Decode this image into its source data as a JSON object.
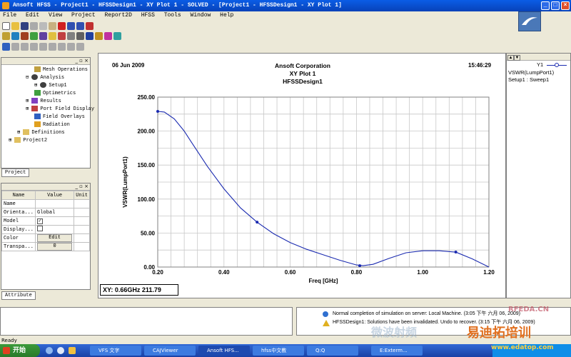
{
  "window": {
    "title": "Ansoft HFSS - Project1 - HFSSDesign1 - XY Plot 1 - SOLVED - [Project1 - HFSSDesign1 - XY Plot 1]"
  },
  "menu": [
    "File",
    "Edit",
    "View",
    "Project",
    "Report2D",
    "HFSS",
    "Tools",
    "Window",
    "Help"
  ],
  "tree": {
    "items": [
      {
        "label": "Mesh Operations"
      },
      {
        "label": "Analysis"
      },
      {
        "label": "Setup1"
      },
      {
        "label": "Optimetrics"
      },
      {
        "label": "Results"
      },
      {
        "label": "Port Field Display"
      },
      {
        "label": "Field Overlays"
      },
      {
        "label": "Radiation"
      },
      {
        "label": "Definitions"
      },
      {
        "label": "Project2"
      }
    ],
    "tab": "Project"
  },
  "properties": {
    "headers": [
      "Name",
      "Value",
      "Unit"
    ],
    "rows": [
      {
        "name": "Name",
        "value": ""
      },
      {
        "name": "Orienta...",
        "value": "Global"
      },
      {
        "name": "Model",
        "value": "✓"
      },
      {
        "name": "Display...",
        "value": ""
      },
      {
        "name": "Color",
        "value": "Edit"
      },
      {
        "name": "Transpa...",
        "value": "0"
      }
    ],
    "tab": "Attribute"
  },
  "plot": {
    "date": "06 Jun 2009",
    "time": "15:46:29",
    "company": "Ansoft Corporation",
    "readout": "XY: 0.66GHz 211.79"
  },
  "chart_data": {
    "type": "line",
    "title": "XY Plot 1",
    "subtitle": "HFSSDesign1",
    "xlabel": "Freq [GHz]",
    "ylabel": "VSWR(LumpPort1)",
    "xlim": [
      0.2,
      1.2
    ],
    "ylim": [
      0,
      250
    ],
    "xticks": [
      "0.20",
      "0.40",
      "0.60",
      "0.80",
      "1.00",
      "1.20"
    ],
    "yticks": [
      "0.00",
      "50.00",
      "100.00",
      "150.00",
      "200.00",
      "250.00"
    ],
    "grid": true,
    "series": [
      {
        "name": "VSWR(LumpPort1)",
        "color": "#1a2ab0",
        "x": [
          0.2,
          0.22,
          0.25,
          0.28,
          0.3,
          0.35,
          0.4,
          0.45,
          0.5,
          0.55,
          0.6,
          0.65,
          0.7,
          0.75,
          0.8,
          0.82,
          0.85,
          0.9,
          0.95,
          1.0,
          1.05,
          1.1,
          1.15,
          1.2
        ],
        "values": [
          229,
          228,
          218,
          200,
          185,
          148,
          115,
          87,
          66,
          49,
          36,
          26,
          18,
          10,
          3,
          2,
          4,
          13,
          21,
          24,
          24,
          22,
          12,
          0
        ]
      }
    ],
    "markers": [
      {
        "x": 0.2,
        "y": 229
      },
      {
        "x": 0.5,
        "y": 66
      },
      {
        "x": 0.81,
        "y": 2
      },
      {
        "x": 1.1,
        "y": 22
      }
    ]
  },
  "legend": {
    "name": "Y1",
    "lines": [
      "VSWR(LumpPort1)",
      "Setup1 : Sweep1"
    ]
  },
  "messages": [
    "Normal completion of simulation on server: Local Machine. (3:05 下午 六月 06, 2009)",
    "HFSSDesign1: Solutions have been invalidated. Undo to recover. (3:15 下午 六月 06, 2009)"
  ],
  "status": "Ready",
  "taskbar": {
    "start": "开始",
    "tasks": [
      "VFS 文字",
      "CAJViewer",
      "Ansoft HFS...",
      "hfss中文教",
      "Q:Q",
      "E:Exterm..."
    ]
  },
  "watermarks": [
    "易迪拓培训",
    "RFEDA.CN",
    "www.edatop.com",
    "微波射频"
  ]
}
